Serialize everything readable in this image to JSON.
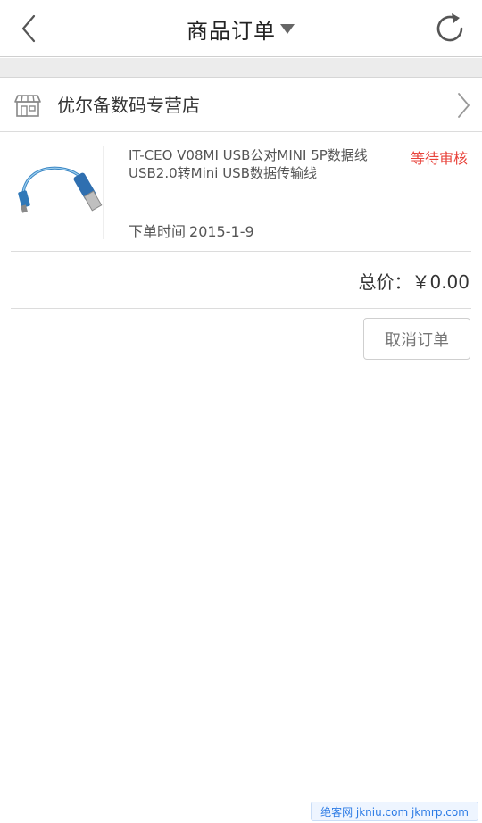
{
  "header": {
    "title": "商品订单",
    "back_icon": "chevron-left-icon",
    "dropdown_icon": "triangle-down-icon",
    "refresh_icon": "refresh-icon"
  },
  "store": {
    "name": "优尔备数码专营店",
    "icon": "store-icon",
    "chevron_icon": "chevron-right-icon"
  },
  "order": {
    "product_title": "IT-CEO V08MI USB公对MINI 5P数据线USB2.0转Mini USB数据传输线",
    "status": "等待审核",
    "order_time_label": "下单时间",
    "order_time_value": "2015-1-9",
    "total_label": "总价：",
    "total_value": "￥0.00",
    "cancel_label": "取消订单"
  },
  "watermark": {
    "text": "绝客网 jkniu.com jkmrp.com"
  },
  "colors": {
    "status_red": "#e8423a",
    "band_gray": "#ececec",
    "divider": "#dcdcdc"
  }
}
